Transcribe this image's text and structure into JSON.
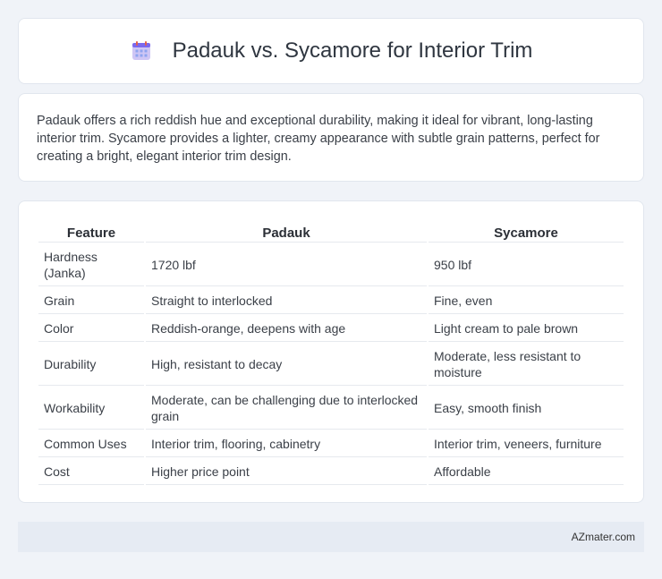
{
  "header": {
    "title": "Padauk vs. Sycamore for Interior Trim",
    "icon": "calendar-icon"
  },
  "description": "Padauk offers a rich reddish hue and exceptional durability, making it ideal for vibrant, long-lasting interior trim. Sycamore provides a lighter, creamy appearance with subtle grain patterns, perfect for creating a bright, elegant interior trim design.",
  "table": {
    "columns": [
      "Feature",
      "Padauk",
      "Sycamore"
    ],
    "rows": [
      [
        "Hardness (Janka)",
        "1720 lbf",
        "950 lbf"
      ],
      [
        "Grain",
        "Straight to interlocked",
        "Fine, even"
      ],
      [
        "Color",
        "Reddish-orange, deepens with age",
        "Light cream to pale brown"
      ],
      [
        "Durability",
        "High, resistant to decay",
        "Moderate, less resistant to moisture"
      ],
      [
        "Workability",
        "Moderate, can be challenging due to interlocked grain",
        "Easy, smooth finish"
      ],
      [
        "Common Uses",
        "Interior trim, flooring, cabinetry",
        "Interior trim, veneers, furniture"
      ],
      [
        "Cost",
        "Higher price point",
        "Affordable"
      ]
    ]
  },
  "footer": {
    "brand": "AZmater.com"
  },
  "colors": {
    "background": "#f0f3f8",
    "card": "#ffffff",
    "footer": "#e6ebf3",
    "icon_accent": "#7b68ee"
  }
}
